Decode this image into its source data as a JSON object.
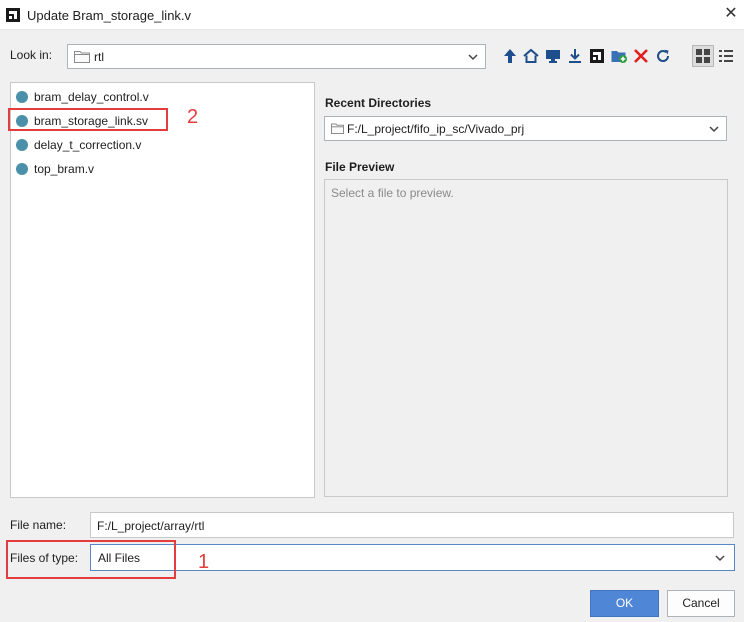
{
  "window": {
    "title": "Update Bram_storage_link.v",
    "close_glyph": "✕"
  },
  "look_in": {
    "label": "Look in:",
    "value": "rtl"
  },
  "toolbar_icons": [
    "up-folder-icon",
    "home-icon",
    "desktop-icon",
    "download-icon",
    "app-logo-icon",
    "new-folder-icon",
    "delete-icon",
    "refresh-icon",
    "grid-view-icon",
    "list-view-icon"
  ],
  "files": [
    {
      "name": "bram_delay_control.v"
    },
    {
      "name": "bram_storage_link.sv"
    },
    {
      "name": "delay_t_correction.v"
    },
    {
      "name": "top_bram.v"
    }
  ],
  "recent": {
    "label": "Recent Directories",
    "value": "F:/L_project/fifo_ip_sc/Vivado_prj"
  },
  "preview": {
    "label": "File Preview",
    "placeholder": "Select a file to preview."
  },
  "file_name": {
    "label": "File name:",
    "value": "F:/L_project/array/rtl"
  },
  "files_of_type": {
    "label": "Files of type:",
    "value": "All Files"
  },
  "buttons": {
    "ok": "OK",
    "cancel": "Cancel"
  },
  "annotations": {
    "num_1": "1",
    "num_2": "2",
    "color": "#e43d3d"
  },
  "colors": {
    "accent": "#4f86d6",
    "file_dot": "#4a90a8",
    "delete_red": "#e02020"
  }
}
